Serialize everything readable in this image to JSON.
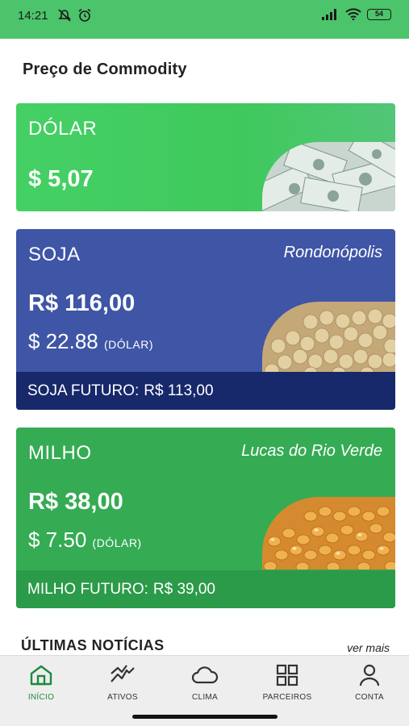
{
  "status_bar": {
    "time": "14:21",
    "battery": "54"
  },
  "page": {
    "title": "Preço de Commodity"
  },
  "cards": {
    "dolar": {
      "name": "DÓLAR",
      "price": "$ 5,07"
    },
    "soja": {
      "name": "SOJA",
      "location": "Rondonópolis",
      "price_brl": "R$ 116,00",
      "price_usd": "$ 22.88",
      "usd_suffix": "(DÓLAR)",
      "future_label": "SOJA FUTURO:",
      "future_value": "R$ 113,00"
    },
    "milho": {
      "name": "MILHO",
      "location": "Lucas do Rio Verde",
      "price_brl": "R$ 38,00",
      "price_usd": "$ 7.50",
      "usd_suffix": "(DÓLAR)",
      "future_label": "MILHO FUTURO:",
      "future_value": "R$ 39,00"
    }
  },
  "news": {
    "title": "ÚLTIMAS NOTÍCIAS",
    "more_label": "ver mais"
  },
  "tabbar": {
    "items": [
      {
        "label": "INÍCIO",
        "icon": "home-icon",
        "active": true
      },
      {
        "label": "ATIVOS",
        "icon": "trending-icon",
        "active": false
      },
      {
        "label": "CLIMA",
        "icon": "cloud-icon",
        "active": false
      },
      {
        "label": "PARCEIROS",
        "icon": "grid-icon",
        "active": false
      },
      {
        "label": "CONTA",
        "icon": "user-icon",
        "active": false
      }
    ],
    "active_color": "#1e8a3c"
  },
  "colors": {
    "status_bar": "#4cc46b",
    "dolar_card": "#45d065",
    "soja_card": "#3f55a6",
    "soja_future": "#17286b",
    "milho_card": "#35ab54",
    "milho_future": "#2b9b49"
  }
}
